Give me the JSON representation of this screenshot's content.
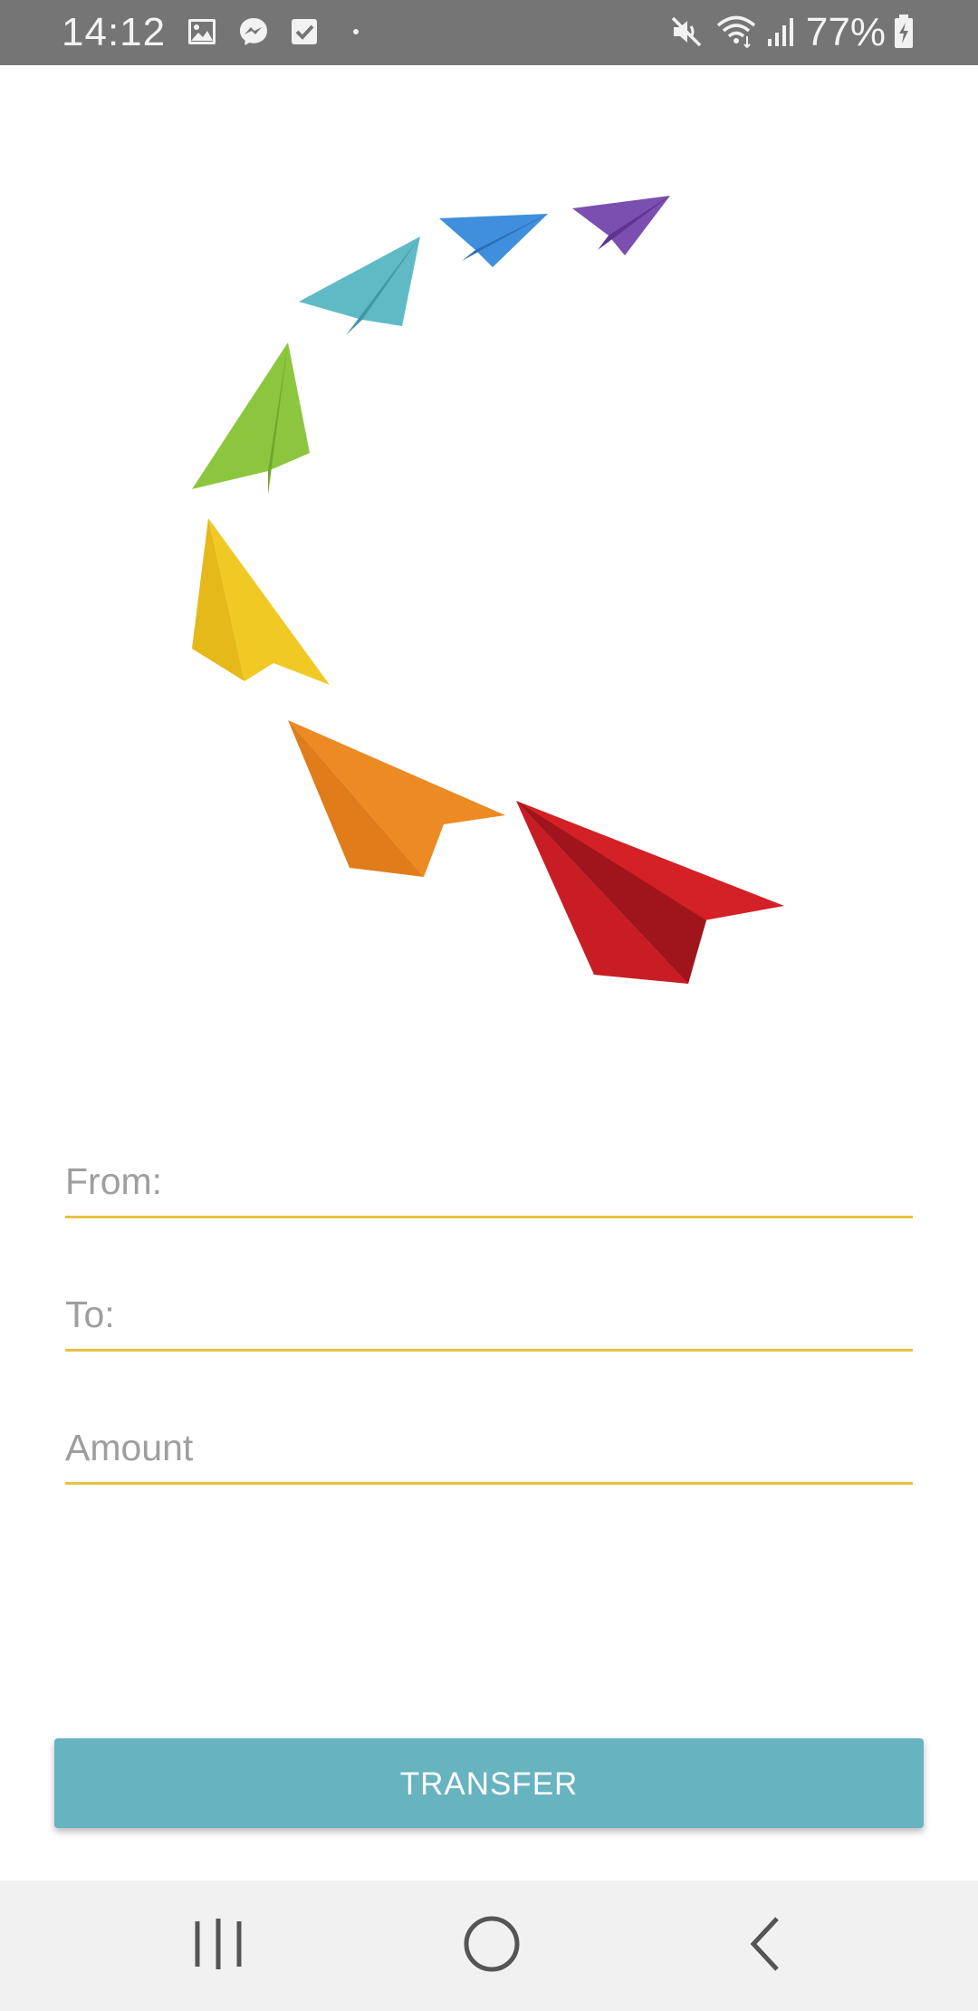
{
  "status_bar": {
    "time": "14:12",
    "battery_percent": "77%",
    "left_icons": [
      "gallery-icon",
      "messenger-icon",
      "check-icon",
      "dot-icon"
    ],
    "right_icons": [
      "mute-icon",
      "wifi-icon",
      "signal-icon",
      "battery-charging-icon"
    ]
  },
  "logo": {
    "icon": "paper-planes-logo",
    "colors": [
      "#7b4fb0",
      "#3f8fdc",
      "#5fbac6",
      "#8cc63f",
      "#f0c925",
      "#ec8a24",
      "#d42027"
    ]
  },
  "form": {
    "from_placeholder": "From:",
    "from_value": "",
    "to_placeholder": "To:",
    "to_value": "",
    "amount_placeholder": "Amount",
    "amount_value": "",
    "underline_color": "#e6c23a"
  },
  "transfer_button": {
    "label": "TRANSFER",
    "color": "#67b3c0"
  },
  "nav_bar": {
    "buttons": [
      "recent-apps-icon",
      "home-icon",
      "back-icon"
    ]
  }
}
